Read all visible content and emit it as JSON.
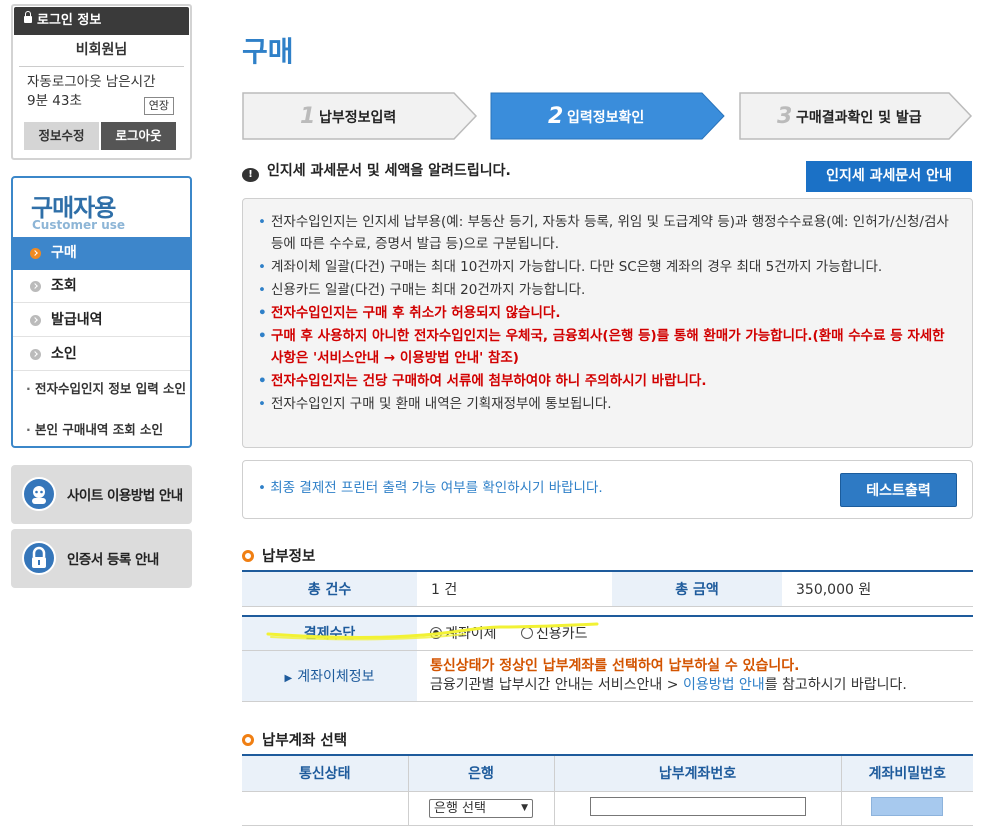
{
  "login": {
    "title": "로그인 정보",
    "user": "비회원님",
    "timer_label": "자동로그아웃 남은시간",
    "timer_value": "9분 43초",
    "extend": "연장",
    "edit": "정보수정",
    "logout": "로그아웃"
  },
  "menu": {
    "title": "구매자용",
    "subtitle": "Customer use",
    "items": [
      {
        "label": "구매",
        "active": true
      },
      {
        "label": "조회"
      },
      {
        "label": "발급내역"
      },
      {
        "label": "소인"
      }
    ],
    "subs": [
      "전자수입인지 정보 입력 소인",
      "본인 구매내역 조회 소인"
    ]
  },
  "banners": [
    "사이트 이용방법 안내",
    "인증서 등록 안내"
  ],
  "page_title": "구매",
  "steps": [
    {
      "num": "1",
      "label": "납부정보입력"
    },
    {
      "num": "2",
      "label": "입력정보확인"
    },
    {
      "num": "3",
      "label": "구매결과확인 및 발급"
    }
  ],
  "notice": {
    "heading": "인지세 과세문서 및 세액을 알려드립니다.",
    "guide_button": "인지세 과세문서 안내",
    "items": [
      {
        "text": "전자수입인지는 인지세 납부용(예: 부동산 등기, 자동차 등록, 위임 및 도급계약 등)과 행정수수료용(예: 인허가/신청/검사 등에 따른 수수료, 증명서 발급 등)으로 구분됩니다.",
        "red": false
      },
      {
        "text": "계좌이체 일괄(다건) 구매는 최대 10건까지 가능합니다. 다만 SC은행 계좌의 경우 최대 5건까지 가능합니다.",
        "red": false
      },
      {
        "text": "신용카드 일괄(다건) 구매는 최대 20건까지 가능합니다.",
        "red": false
      },
      {
        "text": "전자수입인지는 구매 후 취소가 허용되지 않습니다.",
        "red": true
      },
      {
        "text": "구매 후 사용하지 아니한 전자수입인지는 우체국, 금융회사(은행 등)를 통해 환매가 가능합니다.(환매 수수료 등 자세한 사항은 '서비스안내 → 이용방법 안내' 참조)",
        "red": true
      },
      {
        "text": "전자수입인지는 건당 구매하여 서류에 첨부하여야 하니 주의하시기 바랍니다.",
        "red": true
      },
      {
        "text": "전자수입인지 구매 및 환매 내역은 기획재정부에 통보됩니다.",
        "red": false
      }
    ]
  },
  "print": {
    "text": "최종 결제전 프린터 출력 가능 여부를 확인하시기 바랍니다.",
    "button": "테스트출력"
  },
  "payment_info": {
    "heading": "납부정보",
    "count_label": "총 건수",
    "count_value": "1 건",
    "amount_label": "총 금액",
    "amount_value": "350,000 원",
    "method_label": "결제수단",
    "method_options": [
      "계좌이체",
      "신용카드"
    ],
    "method_selected": "계좌이체",
    "transfer_label": "계좌이체정보",
    "transfer_notice": "통신상태가 정상인 납부계좌를 선택하여 납부하실 수 있습니다.",
    "transfer_hint_pre": "금융기관별 납부시간 안내는 서비스안내 > ",
    "transfer_hint_link": "이용방법 안내",
    "transfer_hint_post": "를 참고하시기 바랍니다."
  },
  "account": {
    "heading": "납부계좌 선택",
    "columns": [
      "통신상태",
      "은행",
      "납부계좌번호",
      "계좌비밀번호"
    ],
    "bank_select": "은행 선택"
  }
}
